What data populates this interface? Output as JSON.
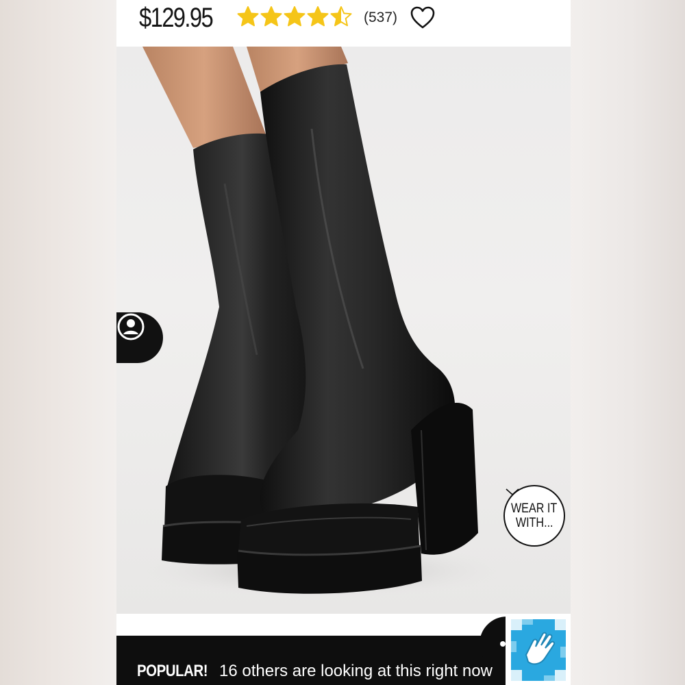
{
  "product": {
    "price": "$129.95",
    "rating": 4.5,
    "rating_max": 5,
    "review_count": "(537)",
    "star_color": "#f5c518"
  },
  "icons": {
    "wishlist": "heart-outline-icon",
    "account": "user-circle-icon",
    "accessibility": "accessibility-hand-icon",
    "chevron": "chevron-down-icon"
  },
  "wear_it": {
    "line1": "WEAR IT",
    "line2": "WITH..."
  },
  "banner": {
    "highlight": "POPULAR!",
    "message": "16 others are looking at this right now"
  },
  "colors": {
    "accent": "#f5c518",
    "banner_bg": "#0e0e0e",
    "access_blue": "#2aa8e0"
  }
}
